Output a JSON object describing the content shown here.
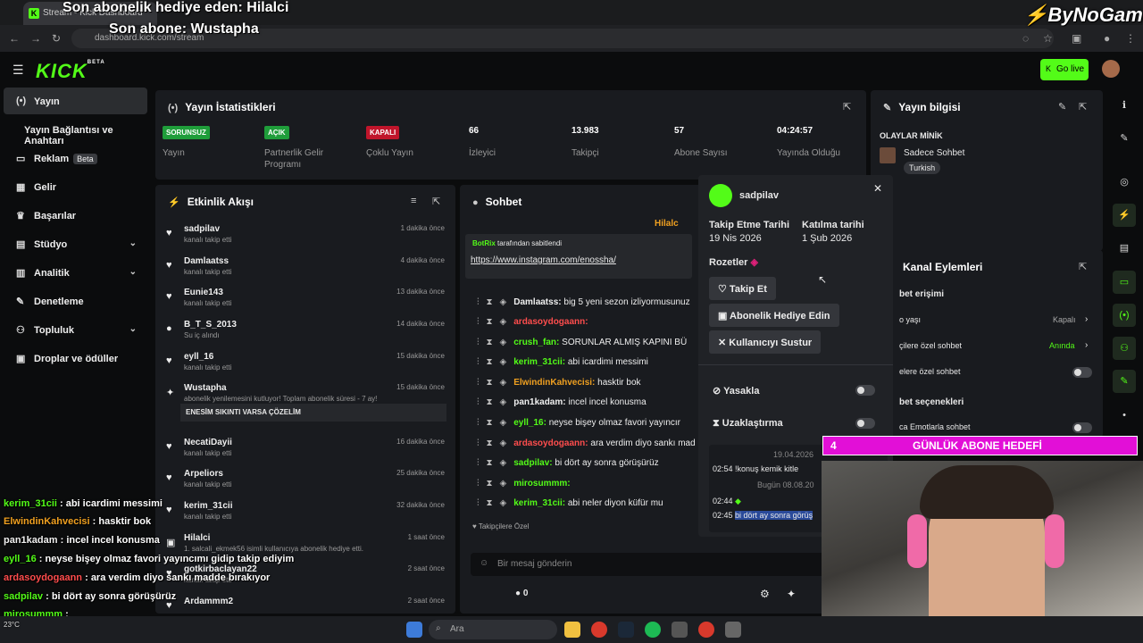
{
  "browser": {
    "tab_title": "Stream - Kick Dashboard",
    "url": "dashboard.kick.com/stream"
  },
  "overlay": {
    "last_gift": "Son abonelik hediye eden: Hilalci",
    "last_sub": "Son abone: Wustapha",
    "watermark": "ByNoGame",
    "goal_count": "4",
    "goal_label": "GÜNLÜK ABONE HEDEFİ"
  },
  "header": {
    "logo": "KICK",
    "logo_beta": "BETA",
    "golive": "Go live"
  },
  "sidebar": {
    "items": [
      {
        "label": "Yayın",
        "icon": "broadcast-icon"
      },
      {
        "label": "Yayın Bağlantısı ve Anahtarı"
      },
      {
        "label": "Reklam",
        "badge": "Beta",
        "icon": "ad-icon"
      },
      {
        "label": "Gelir",
        "icon": "chart-icon"
      },
      {
        "label": "Başarılar",
        "icon": "trophy-icon"
      },
      {
        "label": "Stüdyo",
        "icon": "studio-icon"
      },
      {
        "label": "Analitik",
        "icon": "analytics-icon"
      },
      {
        "label": "Denetleme",
        "icon": "wrench-icon"
      },
      {
        "label": "Topluluk",
        "icon": "users-icon"
      },
      {
        "label": "Droplar ve ödüller",
        "icon": "gift-icon"
      }
    ]
  },
  "stats": {
    "title": "Yayın İstatistikleri",
    "items": [
      {
        "badge": "SORUNSUZ",
        "label": "Yayın",
        "color": "#1f9d3a"
      },
      {
        "badge": "AÇIK",
        "label": "Partnerlik Gelir Programı",
        "color": "#1f9d3a"
      },
      {
        "badge": "KAPALI",
        "label": "Çoklu Yayın",
        "color": "#c0152b"
      },
      {
        "value": "66",
        "label": "İzleyici"
      },
      {
        "value": "13.983",
        "label": "Takipçi"
      },
      {
        "value": "57",
        "label": "Abone Sayısı"
      },
      {
        "value": "04:24:57",
        "label": "Yayında Olduğu"
      }
    ]
  },
  "info": {
    "title": "Yayın bilgisi",
    "category": "OLAYLAR MİNİK",
    "subtitle": "Sadece Sohbet",
    "tag": "Turkish"
  },
  "activity": {
    "title": "Etkinlik Akışı",
    "items": [
      {
        "name": "sadpilav",
        "sub": "kanalı takip etti",
        "time": "1 dakika önce"
      },
      {
        "name": "Damlaatss",
        "sub": "kanalı takip etti",
        "time": "4 dakika önce"
      },
      {
        "name": "Eunie143",
        "sub": "kanalı takip etti",
        "time": "13 dakika önce"
      },
      {
        "name": "B_T_S_2013",
        "sub": "Su iç alındı",
        "time": "14 dakika önce"
      },
      {
        "name": "eyll_16",
        "sub": "kanalı takip etti",
        "time": "15 dakika önce"
      },
      {
        "name": "Wustapha",
        "sub": "abonelik yenilemesini kutluyor! Toplam abonelik süresi - 7 ay!",
        "time": "15 dakika önce",
        "msg": "ENESİM SIKINTI VARSA ÇÖZELİM"
      },
      {
        "name": "NecatiDayii",
        "sub": "kanalı takip etti",
        "time": "16 dakika önce"
      },
      {
        "name": "Arpeliors",
        "sub": "kanalı takip etti",
        "time": "25 dakika önce"
      },
      {
        "name": "kerim_31cii",
        "sub": "kanalı takip etti",
        "time": "32 dakika önce"
      },
      {
        "name": "Hilalci",
        "sub": "1. salcali_ekmek56 isimli kullanıcıya abonelik hediye etti.",
        "time": "1 saat önce"
      },
      {
        "name": "gotkirbaclayan22",
        "sub": "kanalı takip etti",
        "time": "2 saat önce"
      },
      {
        "name": "Ardammm2",
        "sub": "",
        "time": "2 saat önce"
      }
    ]
  },
  "chat": {
    "title": "Sohbet",
    "pinned_by": "BotRix",
    "pinned_by_suffix": "tarafından sabitlendi",
    "pinned_link": "https://www.instagram.com/enossha/",
    "hilalci_tag": "Hilalc",
    "messages": [
      {
        "user": "Damlaatss",
        "color": "#f0f0f0",
        "text": "big 5 yeni sezon izliyormusunuz"
      },
      {
        "user": "ardasoydogaann",
        "color": "#ff4d4d",
        "text": ""
      },
      {
        "user": "crush_fan",
        "color": "#53fc18",
        "text": "SORUNLAR ALMIŞ KAPINI BÜ"
      },
      {
        "user": "kerim_31cii",
        "color": "#53fc18",
        "text": "abi icardimi messimi"
      },
      {
        "user": "ElwindinKahvecisi",
        "color": "#f0a020",
        "text": "hasktir bok"
      },
      {
        "user": "pan1kadam",
        "color": "#f0f0f0",
        "text": "incel incel konusma"
      },
      {
        "user": "eyll_16",
        "color": "#53fc18",
        "text": "neyse bişey olmaz favori yayıncır"
      },
      {
        "user": "ardasoydogaann",
        "color": "#ff4d4d",
        "text": "ara verdim diyo sankı mad"
      },
      {
        "user": "sadpilav",
        "color": "#53fc18",
        "text": "bi dört ay sonra görüşürüz"
      },
      {
        "user": "mirosummm",
        "color": "#53fc18",
        "text": ""
      },
      {
        "user": "kerim_31cii",
        "color": "#53fc18",
        "text": "abi neler diyon küfür mu"
      }
    ],
    "followers_only": "Takipçilere Özel",
    "input_placeholder": "Bir mesaj gönderin",
    "count": "0"
  },
  "popup": {
    "username": "sadpilav",
    "follow_label": "Takip Etme Tarihi",
    "follow_date": "19 Nis 2026",
    "join_label": "Katılma tarihi",
    "join_date": "1 Şub 2026",
    "badges_label": "Rozetler",
    "btn_follow": "Takip Et",
    "btn_gift": "Abonelik Hediye Edin",
    "btn_mute": "Kullanıcıyı Sustur",
    "ban": "Yasakla",
    "timeout": "Uzaklaştırma",
    "date1": "19.04.2026",
    "msg1_time": "02:54",
    "msg1": "!konuş kemik kitle",
    "date2": "Bugün 08.08.20",
    "msg2_time": "02:44",
    "msg3_time": "02:45",
    "msg3": "bi dört ay sonra görüş"
  },
  "channel_actions": {
    "title": "Kanal Eylemleri",
    "section1": "bet erişimi",
    "row1": "o yaşı",
    "row1_val": "Kapalı",
    "row2": "çilere özel sohbet",
    "row2_val": "Anında",
    "row3": "elere özel sohbet",
    "section2": "bet seçenekleri",
    "row4": "ca Emotlarla sohbet"
  },
  "left_chat": [
    {
      "user": "kerim_31cii",
      "color": "#53fc18",
      "text": "abi icardimi messimi"
    },
    {
      "user": "ElwindinKahvecisi",
      "color": "#f0a020",
      "text": "hasktir bok"
    },
    {
      "user": "pan1kadam",
      "color": "#f0f0f0",
      "text": "incel incel konusma"
    },
    {
      "user": "eyll_16",
      "color": "#53fc18",
      "text": "neyse bişey olmaz favori yayıncımı gidip takip ediyim"
    },
    {
      "user": "ardasoydogaann",
      "color": "#ff4d4d",
      "text": "ara verdim diyo sankı madde bırakıyor"
    },
    {
      "user": "sadpilav",
      "color": "#53fc18",
      "text": "bi dört ay sonra görüşürüz"
    },
    {
      "user": "mirosummm",
      "color": "#53fc18",
      "text": ""
    },
    {
      "user": "kerim_31cii",
      "color": "#53fc18",
      "text": "abi neler diyon küfür mu"
    }
  ],
  "taskbar": {
    "search": "Ara",
    "weather": "23°C"
  }
}
